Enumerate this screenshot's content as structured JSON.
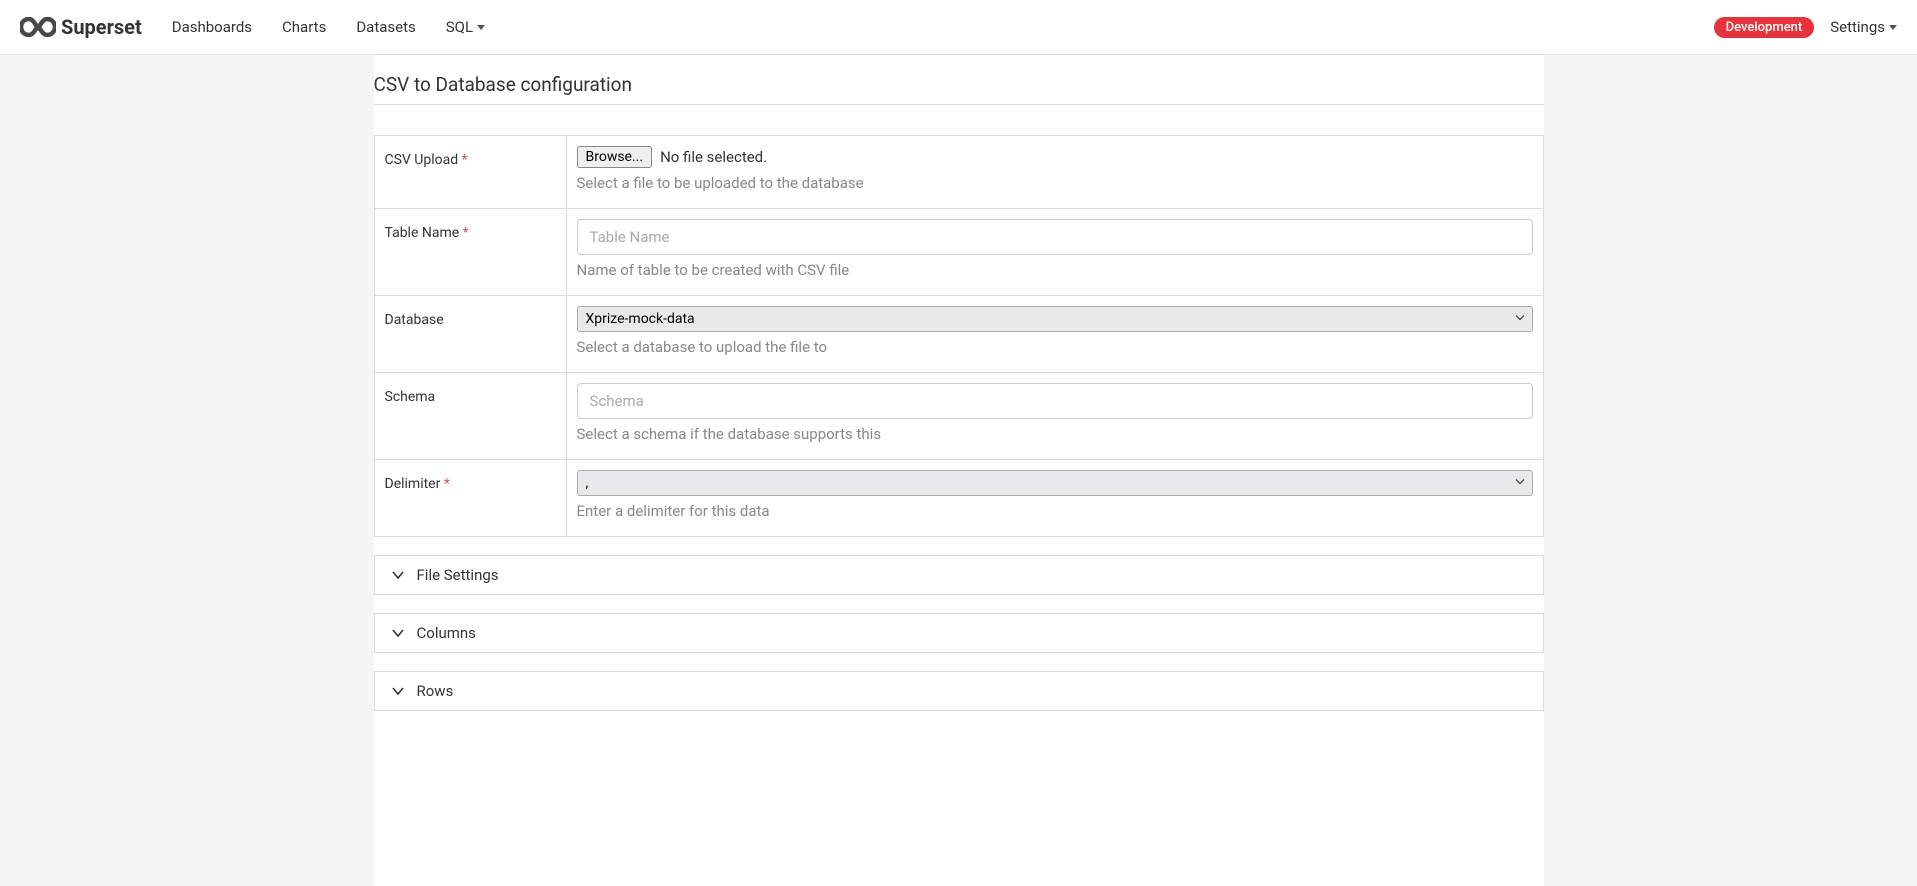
{
  "brand": "Superset",
  "nav": {
    "dashboards": "Dashboards",
    "charts": "Charts",
    "datasets": "Datasets",
    "sql": "SQL"
  },
  "env_badge": "Development",
  "settings_label": "Settings",
  "page_title": "CSV to Database configuration",
  "form": {
    "csv_upload": {
      "label": "CSV Upload",
      "browse": "Browse...",
      "no_file": "No file selected.",
      "help": "Select a file to be uploaded to the database"
    },
    "table_name": {
      "label": "Table Name",
      "placeholder": "Table Name",
      "help": "Name of table to be created with CSV file"
    },
    "database": {
      "label": "Database",
      "value": "Xprize-mock-data",
      "help": "Select a database to upload the file to"
    },
    "schema": {
      "label": "Schema",
      "placeholder": "Schema",
      "help": "Select a schema if the database supports this"
    },
    "delimiter": {
      "label": "Delimiter",
      "value": ",",
      "help": "Enter a delimiter for this data"
    }
  },
  "accordions": {
    "file_settings": "File Settings",
    "columns": "Columns",
    "rows": "Rows"
  }
}
